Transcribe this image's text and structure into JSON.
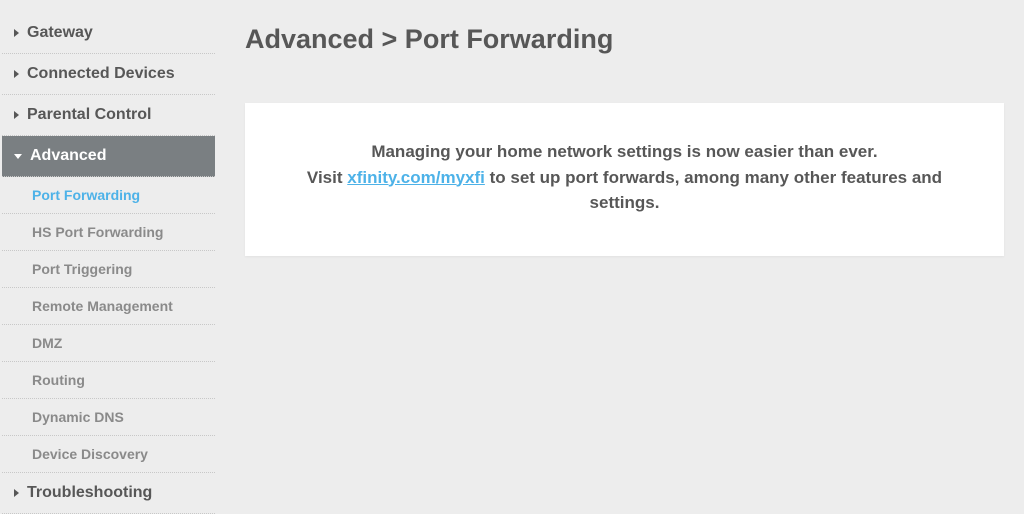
{
  "page_title": "Advanced > Port Forwarding",
  "sidebar": {
    "items": [
      {
        "label": "Gateway"
      },
      {
        "label": "Connected Devices"
      },
      {
        "label": "Parental Control"
      },
      {
        "label": "Advanced"
      },
      {
        "label": "Troubleshooting"
      }
    ],
    "subitems": [
      {
        "label": "Port Forwarding"
      },
      {
        "label": "HS Port Forwarding"
      },
      {
        "label": "Port Triggering"
      },
      {
        "label": "Remote Management"
      },
      {
        "label": "DMZ"
      },
      {
        "label": "Routing"
      },
      {
        "label": "Dynamic DNS"
      },
      {
        "label": "Device Discovery"
      }
    ]
  },
  "content": {
    "line1": "Managing your home network settings is now easier than ever.",
    "line2_prefix": "Visit ",
    "link_text": "xfinity.com/myxfi",
    "line2_suffix": " to set up port forwards, among many other features and settings."
  }
}
